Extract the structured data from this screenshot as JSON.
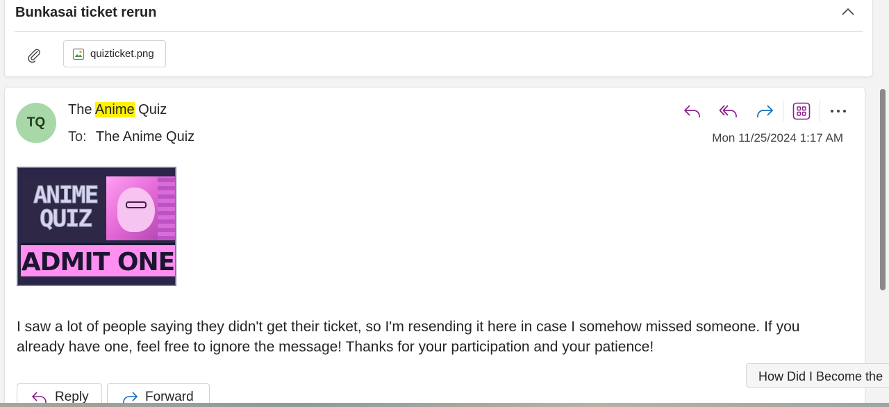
{
  "thread": {
    "subject": "Bunkasai ticket rerun",
    "attachment": {
      "name": "quizticket.png"
    }
  },
  "message": {
    "avatar_initials": "TQ",
    "sender_prefix": "The ",
    "sender_highlight": "Anime",
    "sender_suffix": " Quiz",
    "to_label": "To:",
    "to_value": "The Anime Quiz",
    "date": "Mon 11/25/2024 1:17 AM",
    "image": {
      "line1": "ANIME",
      "line2": "QUIZ",
      "band": "ADMIT ONE"
    },
    "body": "I saw a lot of people saying they didn't get their ticket, so I'm resending it here in case I somehow missed someone. If you already have one, feel free to ignore the message! Thanks for your participation and your patience!",
    "reply_label": "Reply",
    "forward_label": "Forward"
  },
  "tooltip": "How Did I Become the",
  "colors": {
    "accent_purple": "#8b1a8b",
    "accent_blue": "#0f6cbd",
    "avatar_bg": "#a8d8a8",
    "highlight": "#fff200"
  },
  "icons": [
    "chevron-up-icon",
    "paperclip-icon",
    "image-file-icon",
    "reply-icon",
    "reply-all-icon",
    "forward-icon",
    "apps-icon",
    "more-icon"
  ]
}
